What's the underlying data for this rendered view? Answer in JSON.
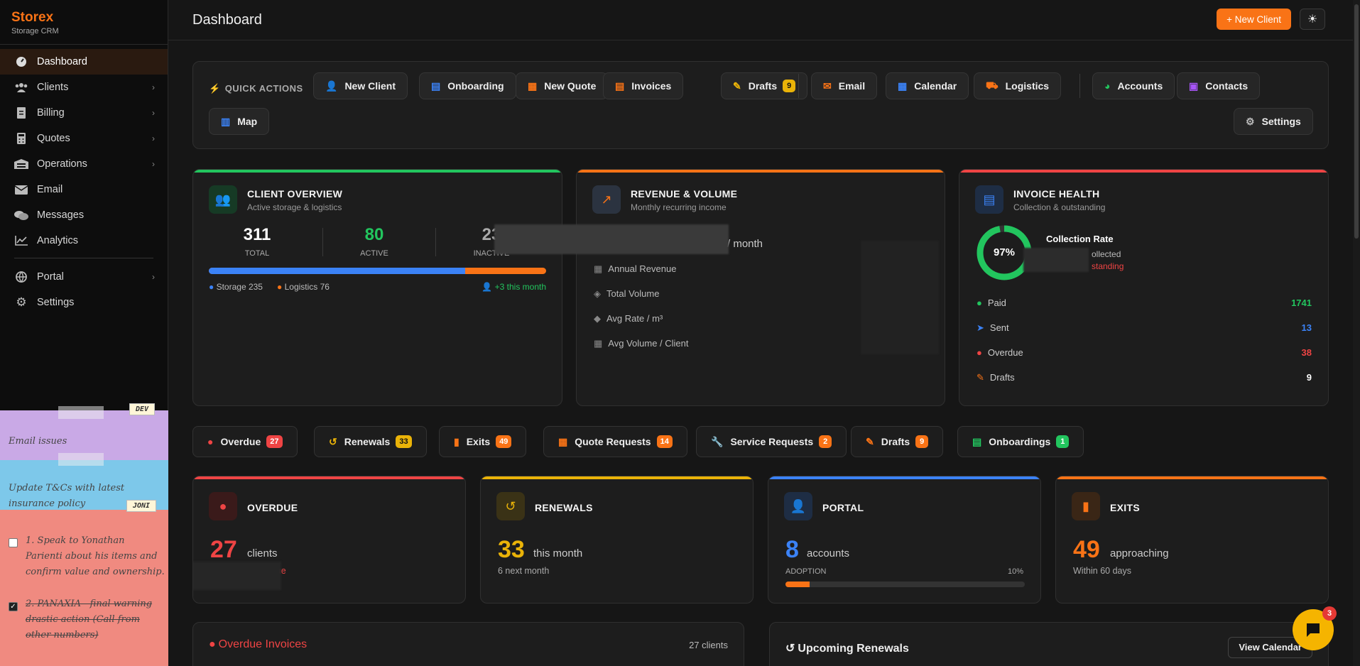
{
  "brand": {
    "name": "Storex",
    "sub": "Storage CRM"
  },
  "sidebar": {
    "items": [
      {
        "label": "Dashboard",
        "icon": "gauge-icon"
      },
      {
        "label": "Clients",
        "icon": "users-icon"
      },
      {
        "label": "Billing",
        "icon": "invoice-icon"
      },
      {
        "label": "Quotes",
        "icon": "calculator-icon"
      },
      {
        "label": "Operations",
        "icon": "warehouse-icon"
      },
      {
        "label": "Email",
        "icon": "envelope-icon"
      },
      {
        "label": "Messages",
        "icon": "chat-icon"
      },
      {
        "label": "Analytics",
        "icon": "chart-line-icon"
      },
      {
        "label": "Portal",
        "icon": "globe-icon"
      },
      {
        "label": "Settings",
        "icon": "gear-icon"
      }
    ]
  },
  "notes": {
    "tag_dev": "DEV",
    "tag_joni": "JONI",
    "note1": "Email issues",
    "note2_line1": "Update T&Cs with latest",
    "note2_line2": "insurance policy",
    "todo1_line1": "1. Speak to Yonathan",
    "todo1_line2": "Parienti about his items and",
    "todo1_line3": "confirm value and ownership.",
    "todo2_line1": "2. PANAXIA - final warning",
    "todo2_line2": "drastic action (Call from",
    "todo2_line3": "other numbers)"
  },
  "header": {
    "title": "Dashboard",
    "new_client": "+ New Client"
  },
  "quick_actions": {
    "label": "QUICK ACTIONS",
    "buttons": [
      {
        "label": "New Client"
      },
      {
        "label": "Onboarding"
      },
      {
        "label": "New Quote"
      },
      {
        "label": "Invoices"
      },
      {
        "label": "Drafts",
        "badge": "9"
      },
      {
        "label": "Email"
      },
      {
        "label": "Calendar"
      },
      {
        "label": "Logistics"
      },
      {
        "label": "Accounts"
      },
      {
        "label": "Contacts"
      },
      {
        "label": "Map"
      },
      {
        "label": "Settings"
      }
    ]
  },
  "client_overview": {
    "title": "CLIENT OVERVIEW",
    "sub": "Active storage & logistics",
    "total": "311",
    "total_label": "TOTAL",
    "active": "80",
    "active_label": "ACTIVE",
    "inactive": "23",
    "inactive_label": "INACTIVE",
    "storage": "Storage 235",
    "logistics": "Logistics 76",
    "delta": "+3 this month",
    "storage_fraction": 0.76
  },
  "revenue": {
    "title": "REVENUE & VOLUME",
    "sub": "Monthly recurring income",
    "per_month": "/ month",
    "rows": [
      "Annual Revenue",
      "Total Volume",
      "Avg Rate / m³",
      "Avg Volume / Client"
    ]
  },
  "invoice_health": {
    "title": "INVOICE HEALTH",
    "sub": "Collection & outstanding",
    "rate": "97%",
    "rate_fraction": 0.97,
    "rate_label": "Collection Rate",
    "collected": "ollected",
    "outstanding": "standing",
    "rows": [
      {
        "label": "Paid",
        "value": "1741",
        "color": "#22c55e"
      },
      {
        "label": "Sent",
        "value": "13",
        "color": "#3b82f6"
      },
      {
        "label": "Overdue",
        "value": "38",
        "color": "#ef4444"
      },
      {
        "label": "Drafts",
        "value": "9",
        "color": "#ffffff"
      }
    ]
  },
  "pills": [
    {
      "label": "Overdue",
      "badge": "27",
      "color": "#ef4444"
    },
    {
      "label": "Renewals",
      "badge": "33",
      "color": "#eab308"
    },
    {
      "label": "Exits",
      "badge": "49",
      "color": "#f97316"
    },
    {
      "label": "Quote Requests",
      "badge": "14",
      "color": "#f97316"
    },
    {
      "label": "Service Requests",
      "badge": "2",
      "color": "#f97316"
    },
    {
      "label": "Drafts",
      "badge": "9",
      "color": "#f97316"
    },
    {
      "label": "Onboardings",
      "badge": "1",
      "color": "#22c55e"
    }
  ],
  "kpis": {
    "overdue": {
      "title": "OVERDUE",
      "value": "27",
      "unit": "clients",
      "sub": "lue"
    },
    "renewals": {
      "title": "RENEWALS",
      "value": "33",
      "unit": "this month",
      "sub": "6 next month"
    },
    "portal": {
      "title": "PORTAL",
      "value": "8",
      "unit": "accounts",
      "adoption_label": "ADOPTION",
      "adoption": "10%",
      "adoption_fraction": 0.1
    },
    "exits": {
      "title": "EXITS",
      "value": "49",
      "unit": "approaching",
      "sub": "Within 60 days"
    }
  },
  "overdue_invoices": {
    "title": "Overdue Invoices",
    "count": "27 clients"
  },
  "upcoming_renewals": {
    "title": "Upcoming Renewals",
    "button": "View Calendar"
  },
  "chat": {
    "badge": "3"
  }
}
